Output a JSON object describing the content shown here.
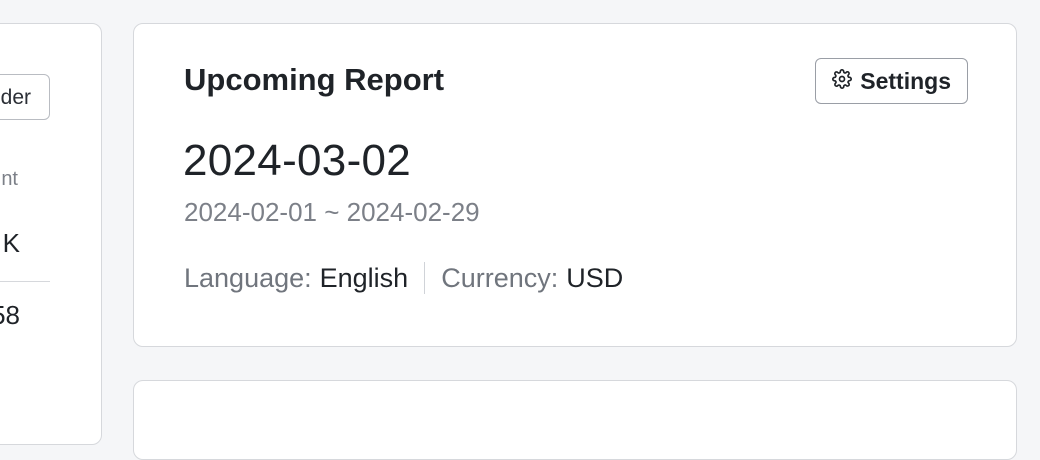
{
  "left_panel": {
    "button_label": "der",
    "muted_label": "nt",
    "value_1": "K",
    "value_2": "58"
  },
  "report": {
    "title": "Upcoming Report",
    "settings_label": "Settings",
    "date": "2024-03-02",
    "range": "2024-02-01 ~ 2024-02-29",
    "language_label": "Language:",
    "language_value": "English",
    "currency_label": "Currency:",
    "currency_value": "USD"
  },
  "icons": {
    "settings": "gear-icon"
  }
}
